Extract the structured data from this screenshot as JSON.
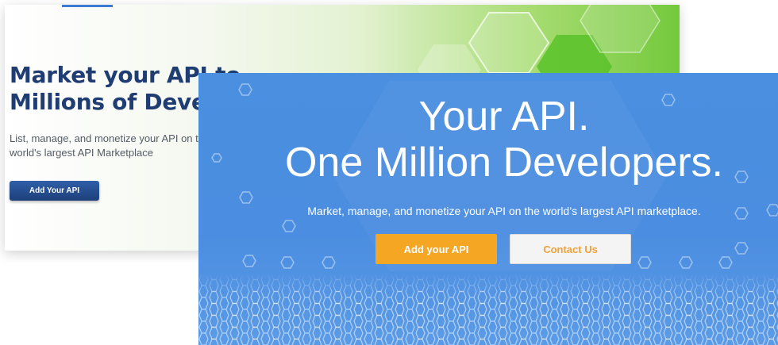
{
  "back_card": {
    "title_line1": "Market your API to",
    "title_line2": "Millions of Developers",
    "description": "List, manage, and monetize your API on the world's largest API Marketplace",
    "button_label": "Add Your API"
  },
  "front_card": {
    "title_line1": "Your API.",
    "title_line2": "One Million Developers.",
    "subtitle": "Market, manage, and monetize your API on the world’s largest API marketplace.",
    "primary_button": "Add your API",
    "secondary_button": "Contact Us"
  },
  "colors": {
    "primary_blue": "#4a8fe0",
    "accent_orange": "#f5a623",
    "navy": "#1f3d73",
    "green": "#74c93c"
  }
}
